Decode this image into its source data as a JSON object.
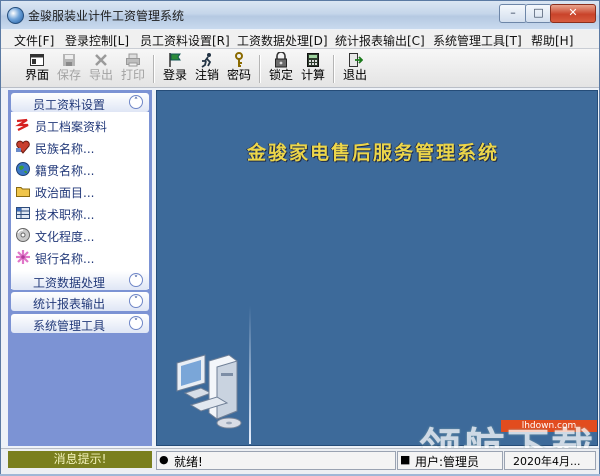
{
  "window": {
    "title": "金骏服装业计件工资管理系统",
    "min": "–",
    "max": "□",
    "close": "✕"
  },
  "menu": [
    "文件[F]",
    "登录控制[L]",
    "员工资料设置[R]",
    "工资数据处理[D]",
    "统计报表输出[C]",
    "系统管理工具[T]",
    "帮助[H]"
  ],
  "toolbar": {
    "items": [
      {
        "label": "界面",
        "icon": "window-icon",
        "enabled": true
      },
      {
        "label": "保存",
        "icon": "save-icon",
        "enabled": false
      },
      {
        "label": "导出",
        "icon": "export-icon",
        "enabled": false
      },
      {
        "label": "打印",
        "icon": "print-icon",
        "enabled": false
      },
      {
        "label": "登录",
        "icon": "flag-icon",
        "enabled": true
      },
      {
        "label": "注销",
        "icon": "runner-icon",
        "enabled": true
      },
      {
        "label": "密码",
        "icon": "key-icon",
        "enabled": true
      },
      {
        "label": "锁定",
        "icon": "lock-icon",
        "enabled": true
      },
      {
        "label": "计算",
        "icon": "calculator-icon",
        "enabled": true
      },
      {
        "label": "退出",
        "icon": "exit-icon",
        "enabled": true
      }
    ]
  },
  "sidebar": {
    "group1": {
      "title": "员工资料设置",
      "items": [
        {
          "label": "员工档案资料",
          "icon": "employee-file-icon"
        },
        {
          "label": "民族名称...",
          "icon": "heart-icon"
        },
        {
          "label": "籍贯名称...",
          "icon": "globe-icon"
        },
        {
          "label": "政治面目...",
          "icon": "folder-icon"
        },
        {
          "label": "技术职称...",
          "icon": "grid-icon"
        },
        {
          "label": "文化程度...",
          "icon": "disc-icon"
        },
        {
          "label": "银行名称...",
          "icon": "flower-icon"
        }
      ]
    },
    "group2": {
      "title": "工资数据处理"
    },
    "group3": {
      "title": "统计报表输出"
    },
    "group4": {
      "title": "系统管理工具"
    }
  },
  "main": {
    "banner": "金骏家电售后服务管理系统"
  },
  "watermark": {
    "url": "lhdown.com",
    "text": "领航下载"
  },
  "status": {
    "tip": "消息提示!",
    "ready": "就绪!",
    "user": "用户:管理员",
    "date": "2020年4月..."
  }
}
